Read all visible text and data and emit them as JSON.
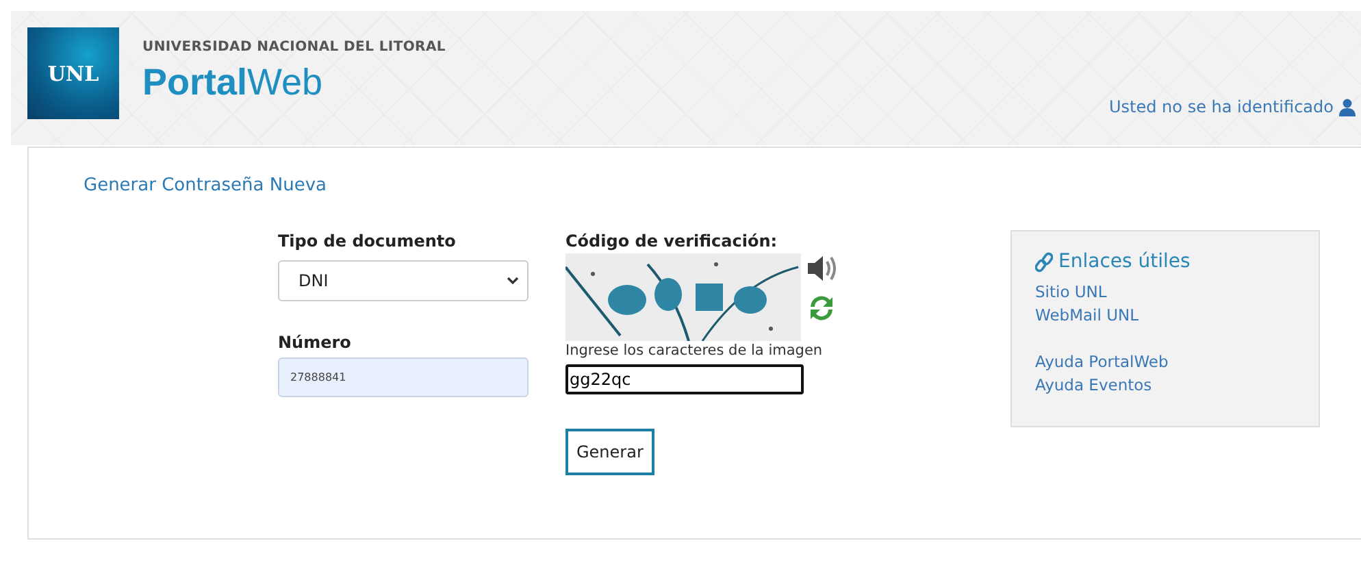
{
  "header": {
    "logo": "UNL",
    "institution": "UNIVERSIDAD NACIONAL DEL LITORAL",
    "portal": "**Portal**Web",
    "user_status": "Usted no se ha identificado"
  },
  "page_title": "Generar Contraseña Nueva",
  "form": {
    "document_type": {
      "label": "Tipo de documento",
      "value": "DNI"
    },
    "number": {
      "label": "Número",
      "value": "27888841"
    },
    "captcha": {
      "label": "Código de verificación:",
      "hint": "Ingrese los caracteres de la imagen",
      "value": "gg22qc"
    },
    "submit": "Generar"
  },
  "links": {
    "title": "Enlaces útiles",
    "groups": [
      [
        "Sitio UNL",
        "WebMail UNL"
      ],
      [
        "Ayuda PortalWeb",
        "Ayuda Eventos"
      ]
    ]
  }
}
